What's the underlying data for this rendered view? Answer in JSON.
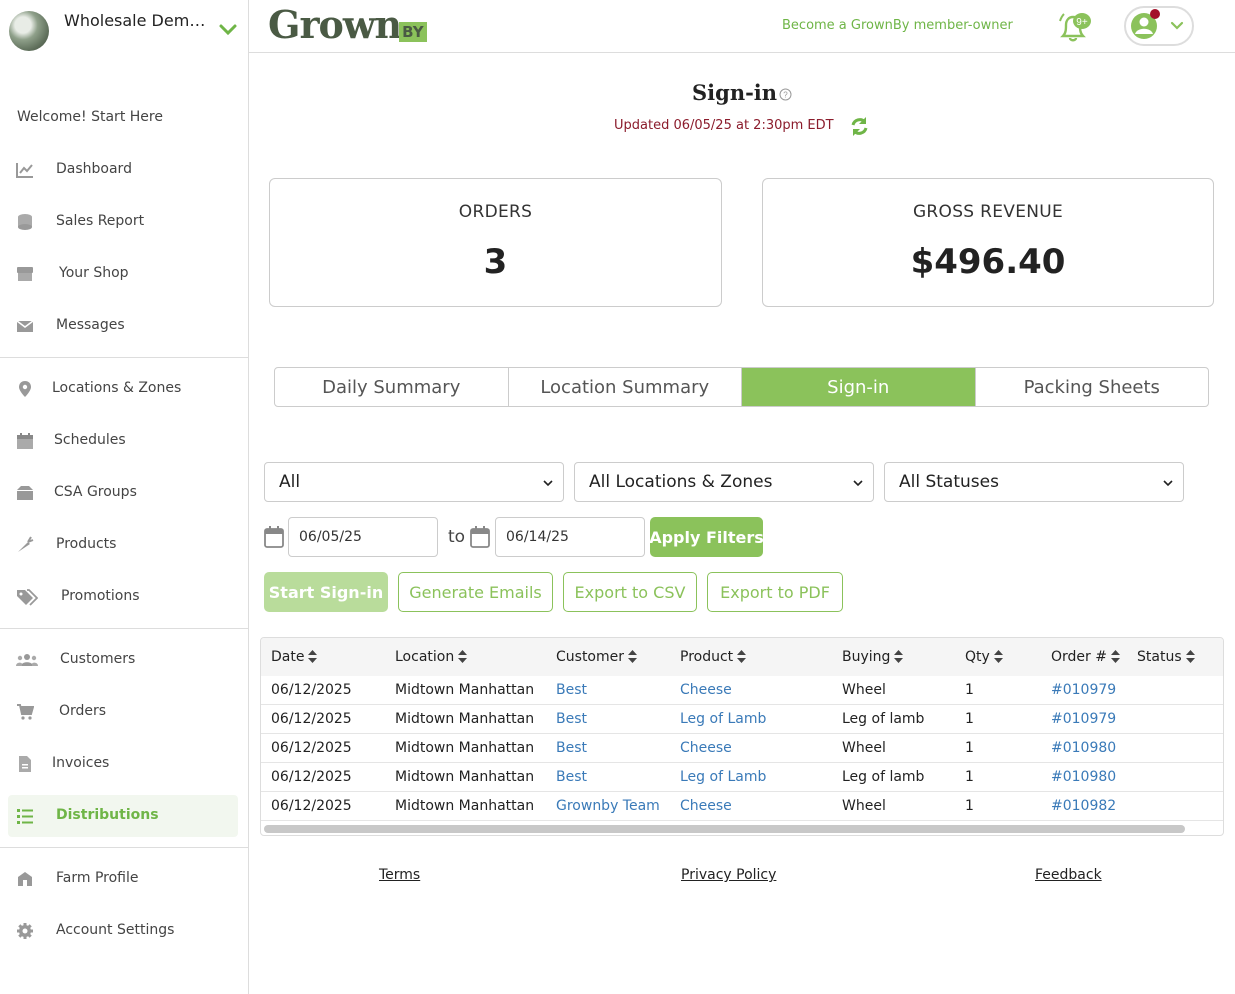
{
  "sidebar": {
    "farm_name": "Wholesale Demonstration ...",
    "welcome": "Welcome! Start Here",
    "items": [
      {
        "label": "Dashboard"
      },
      {
        "label": "Sales Report"
      },
      {
        "label": "Your Shop"
      },
      {
        "label": "Messages"
      },
      {
        "label": "Locations & Zones"
      },
      {
        "label": "Schedules"
      },
      {
        "label": "CSA Groups"
      },
      {
        "label": "Products"
      },
      {
        "label": "Promotions"
      },
      {
        "label": "Customers"
      },
      {
        "label": "Orders"
      },
      {
        "label": "Invoices"
      },
      {
        "label": "Distributions"
      },
      {
        "label": "Farm Profile"
      },
      {
        "label": "Account Settings"
      }
    ],
    "active_item": "Distributions"
  },
  "header": {
    "logo_main": "Grown",
    "logo_by": "BY",
    "member_link": "Become a GrownBy member-owner",
    "notification_badge": "9+"
  },
  "page": {
    "title": "Sign-in",
    "updated": "Updated 06/05/25 at 2:30pm EDT"
  },
  "stats": {
    "orders_label": "ORDERS",
    "orders_value": "3",
    "revenue_label": "GROSS REVENUE",
    "revenue_value": "$496.40"
  },
  "tabs": [
    {
      "label": "Daily Summary"
    },
    {
      "label": "Location Summary"
    },
    {
      "label": "Sign-in"
    },
    {
      "label": "Packing Sheets"
    }
  ],
  "active_tab": "Sign-in",
  "filters": {
    "type_value": "All",
    "location_value": "All Locations & Zones",
    "status_value": "All Statuses",
    "date_from": "06/05/25",
    "to_label": "to",
    "date_to": "06/14/25",
    "apply_label": "Apply Filters"
  },
  "actions": {
    "start_signin": "Start Sign-in",
    "generate_emails": "Generate Emails",
    "export_csv": "Export to CSV",
    "export_pdf": "Export to PDF"
  },
  "table": {
    "columns": [
      "Date",
      "Location",
      "Customer",
      "Product",
      "Buying",
      "Qty",
      "Order #",
      "Status"
    ],
    "rows": [
      [
        "06/12/2025",
        "Midtown Manhattan",
        "Best",
        "Cheese",
        "Wheel",
        "1",
        "#010979",
        ""
      ],
      [
        "06/12/2025",
        "Midtown Manhattan",
        "Best",
        "Leg of Lamb",
        "Leg of lamb",
        "1",
        "#010979",
        ""
      ],
      [
        "06/12/2025",
        "Midtown Manhattan",
        "Best",
        "Cheese",
        "Wheel",
        "1",
        "#010980",
        ""
      ],
      [
        "06/12/2025",
        "Midtown Manhattan",
        "Best",
        "Leg of Lamb",
        "Leg of lamb",
        "1",
        "#010980",
        ""
      ],
      [
        "06/12/2025",
        "Midtown Manhattan",
        "Grownby Team",
        "Cheese",
        "Wheel",
        "1",
        "#010982",
        ""
      ]
    ]
  },
  "footer": {
    "terms": "Terms",
    "privacy": "Privacy Policy",
    "feedback": "Feedback"
  },
  "colors": {
    "brand_green": "#8bc25b",
    "link_blue": "#3a7ab8",
    "updated_red": "#8b1c2c"
  }
}
